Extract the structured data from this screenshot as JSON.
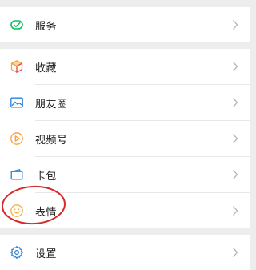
{
  "menu": {
    "services": {
      "label": "服务",
      "icon": "wechat-pay-icon"
    },
    "favorites": {
      "label": "收藏",
      "icon": "cube-icon"
    },
    "moments": {
      "label": "朋友圈",
      "icon": "photo-icon"
    },
    "channels": {
      "label": "视频号",
      "icon": "play-icon"
    },
    "cards": {
      "label": "卡包",
      "icon": "wallet-icon"
    },
    "stickers": {
      "label": "表情",
      "icon": "smiley-icon"
    },
    "settings": {
      "label": "设置",
      "icon": "gear-icon"
    }
  },
  "colors": {
    "background": "#ededed",
    "green": "#07c160",
    "orange": "#fa9d3b",
    "blue": "#2782d7",
    "yellow": "#f4b33d",
    "annotation_red": "#d42a2a"
  }
}
